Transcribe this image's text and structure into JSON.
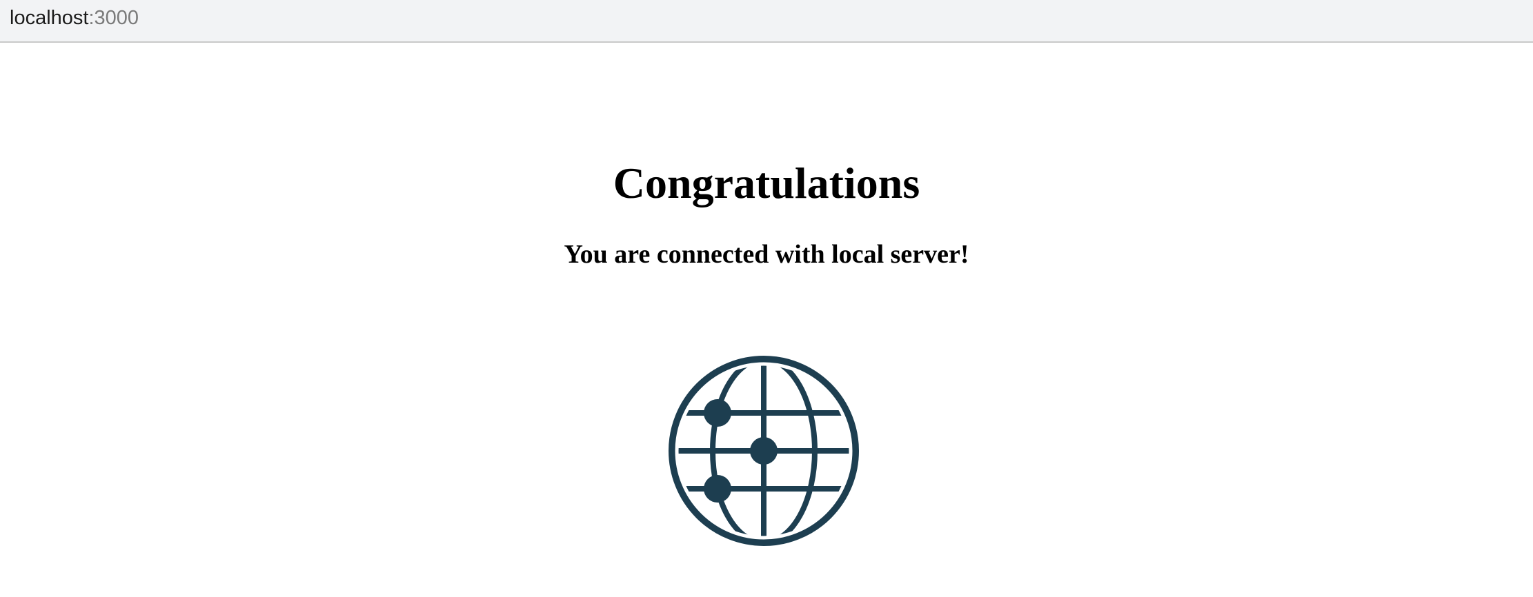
{
  "browser": {
    "url_host": "localhost",
    "url_port": ":3000"
  },
  "page": {
    "heading": "Congratulations",
    "subheading": "You are connected with local server!",
    "icon": "network-globe-icon",
    "icon_color": "#1d3e50"
  }
}
